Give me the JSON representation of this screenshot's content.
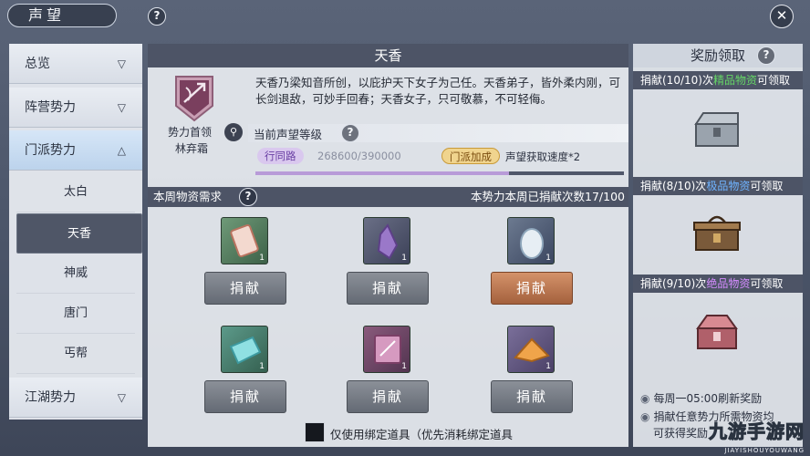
{
  "header": {
    "title": "声望",
    "help": "?",
    "close": "✕"
  },
  "nav": {
    "categories": [
      {
        "label": "总览",
        "chevron": "▽"
      },
      {
        "label": "阵营势力",
        "chevron": "▽"
      },
      {
        "label": "门派势力",
        "chevron": "△"
      },
      {
        "label": "江湖势力",
        "chevron": "▽"
      }
    ],
    "subitems": [
      "太白",
      "天香",
      "神威",
      "唐门",
      "丐帮"
    ]
  },
  "faction": {
    "name": "天香",
    "leader_label": "势力首领",
    "leader_name": "林弃霜",
    "description": "天香乃梁知音所创，以庇护天下女子为己任。天香弟子，皆外柔内刚，可长剑退敌，可妙手回春；天香女子，只可敬慕，不可轻侮。",
    "reputation_title": "当前声望等级",
    "rank": "行同路",
    "progress_text": "268600/390000",
    "progress_fraction": 0.689,
    "bonus_tag": "门派加成",
    "bonus_text": "声望获取速度*2"
  },
  "requirements": {
    "title": "本周物资需求",
    "count_text": "本势力本周已捐献次数17/100",
    "items": [
      {
        "icon": "scroll-item-icon",
        "qty": "1",
        "button": "捐献",
        "highlight": false
      },
      {
        "icon": "purple-crystal-icon",
        "qty": "1",
        "button": "捐献",
        "highlight": false
      },
      {
        "icon": "white-stone-icon",
        "qty": "1",
        "button": "捐献",
        "highlight": true
      },
      {
        "icon": "cyan-cloth-icon",
        "qty": "1",
        "button": "捐献",
        "highlight": false
      },
      {
        "icon": "emblem-scroll-icon",
        "qty": "1",
        "button": "捐献",
        "highlight": false
      },
      {
        "icon": "orange-silk-icon",
        "qty": "1",
        "button": "捐献",
        "highlight": false
      }
    ],
    "bind_option": "仅使用绑定道具（优先消耗绑定道具"
  },
  "rewards": {
    "title": "奖励领取",
    "tiers": [
      {
        "prefix": "捐献(10/10)次",
        "quality": "精品物资",
        "suffix": "可领取",
        "chest": "silver-chest-icon"
      },
      {
        "prefix": "捐献(8/10)次",
        "quality": "极品物资",
        "suffix": "可领取",
        "chest": "bronze-chest-icon"
      },
      {
        "prefix": "捐献(9/10)次",
        "quality": "绝品物资",
        "suffix": "可领取",
        "chest": "red-chest-icon"
      }
    ],
    "notes": [
      "每周一05:00刷新奖励",
      "捐献任意势力所需物资均",
      "可获得奖励"
    ]
  },
  "watermark": {
    "main": "九游手游网",
    "sub": "JIAYISHOUYOUWANG"
  },
  "colors": {
    "panel_header": "#4d5466",
    "highlight_button": "#c07a52",
    "rank_purple": "#6a3fa4"
  }
}
